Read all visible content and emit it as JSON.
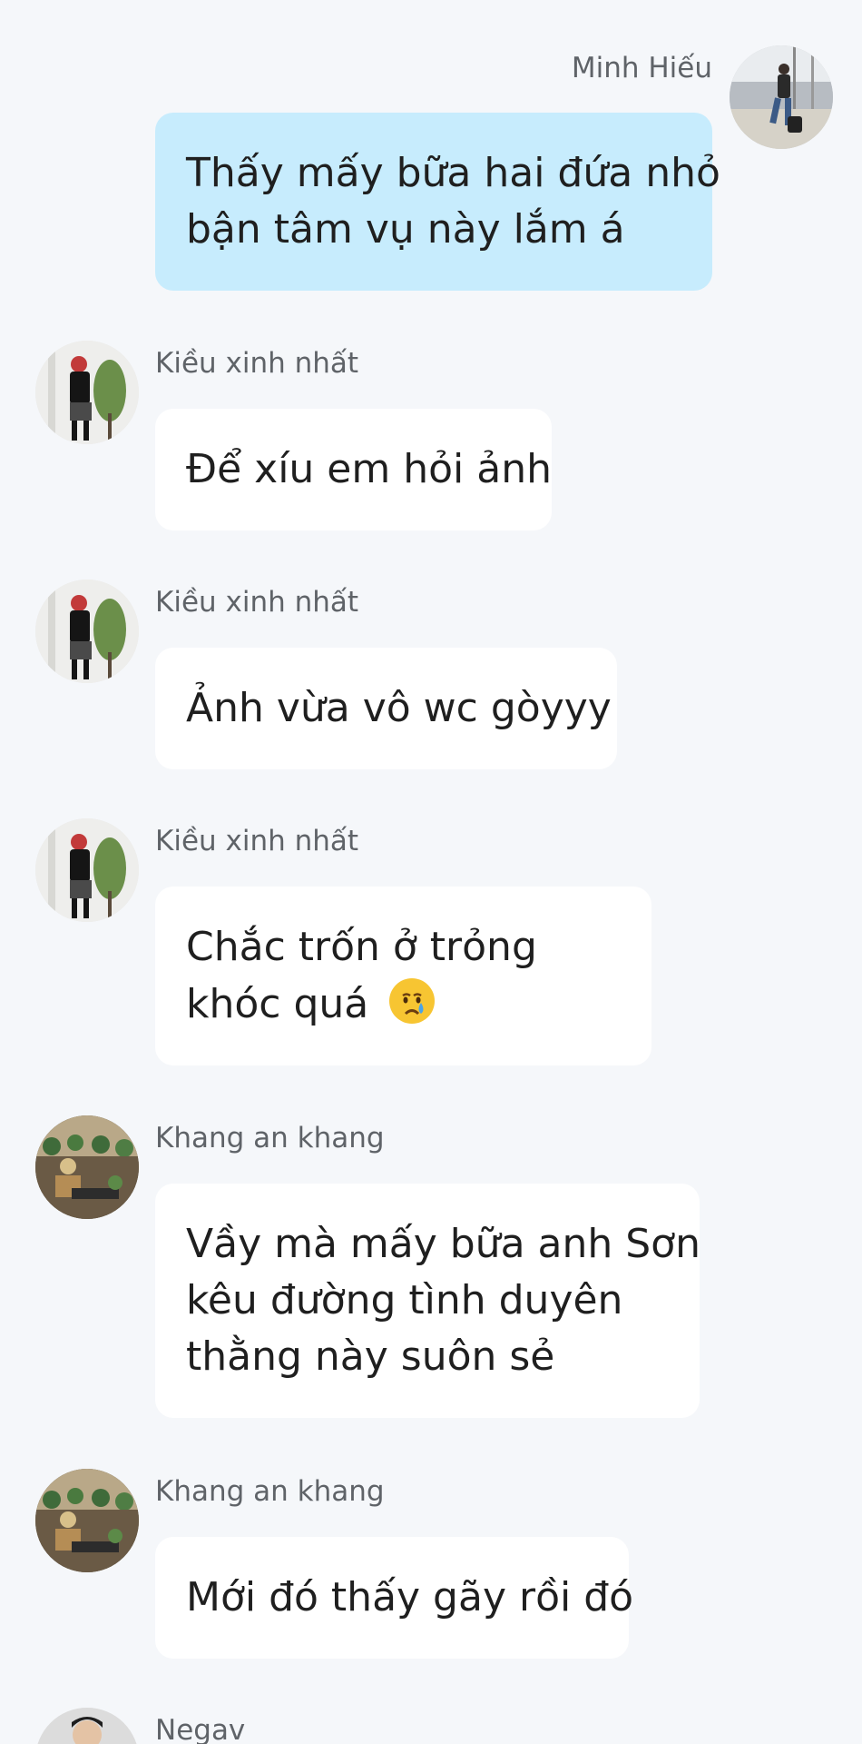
{
  "messages": [
    {
      "sender": "Minh Hiếu",
      "side": "right",
      "avatar": "traveler-avatar",
      "lines": [
        "Thấy mấy bữa hai đứa nhỏ",
        "bận tâm vụ này lắm á"
      ]
    },
    {
      "sender": "Kiều xinh nhất",
      "side": "left",
      "avatar": "kieu-avatar",
      "lines": [
        "Để xíu em hỏi ảnh"
      ]
    },
    {
      "sender": "Kiều xinh nhất",
      "side": "left",
      "avatar": "kieu-avatar",
      "lines": [
        "Ảnh vừa vô wc gòyyy"
      ]
    },
    {
      "sender": "Kiều xinh nhất",
      "side": "left",
      "avatar": "kieu-avatar",
      "lines": [
        "Chắc trốn ở trỏng",
        "khóc quá"
      ],
      "emoji": "crying-face"
    },
    {
      "sender": "Khang an khang",
      "side": "left",
      "avatar": "khang-avatar",
      "lines": [
        "Vầy mà mấy bữa anh Sơn",
        "kêu đường tình duyên",
        "thằng này suôn sẻ"
      ]
    },
    {
      "sender": "Khang an khang",
      "side": "left",
      "avatar": "khang-avatar",
      "lines": [
        "Mới đó thấy gãy rồi đó"
      ]
    },
    {
      "sender": "Negav",
      "side": "left",
      "avatar": "negav-avatar",
      "lines": []
    }
  ],
  "colors": {
    "background": "#f5f7fa",
    "own_bubble": "#c7ecfd",
    "other_bubble": "#ffffff",
    "sender_text": "#5f6368"
  }
}
